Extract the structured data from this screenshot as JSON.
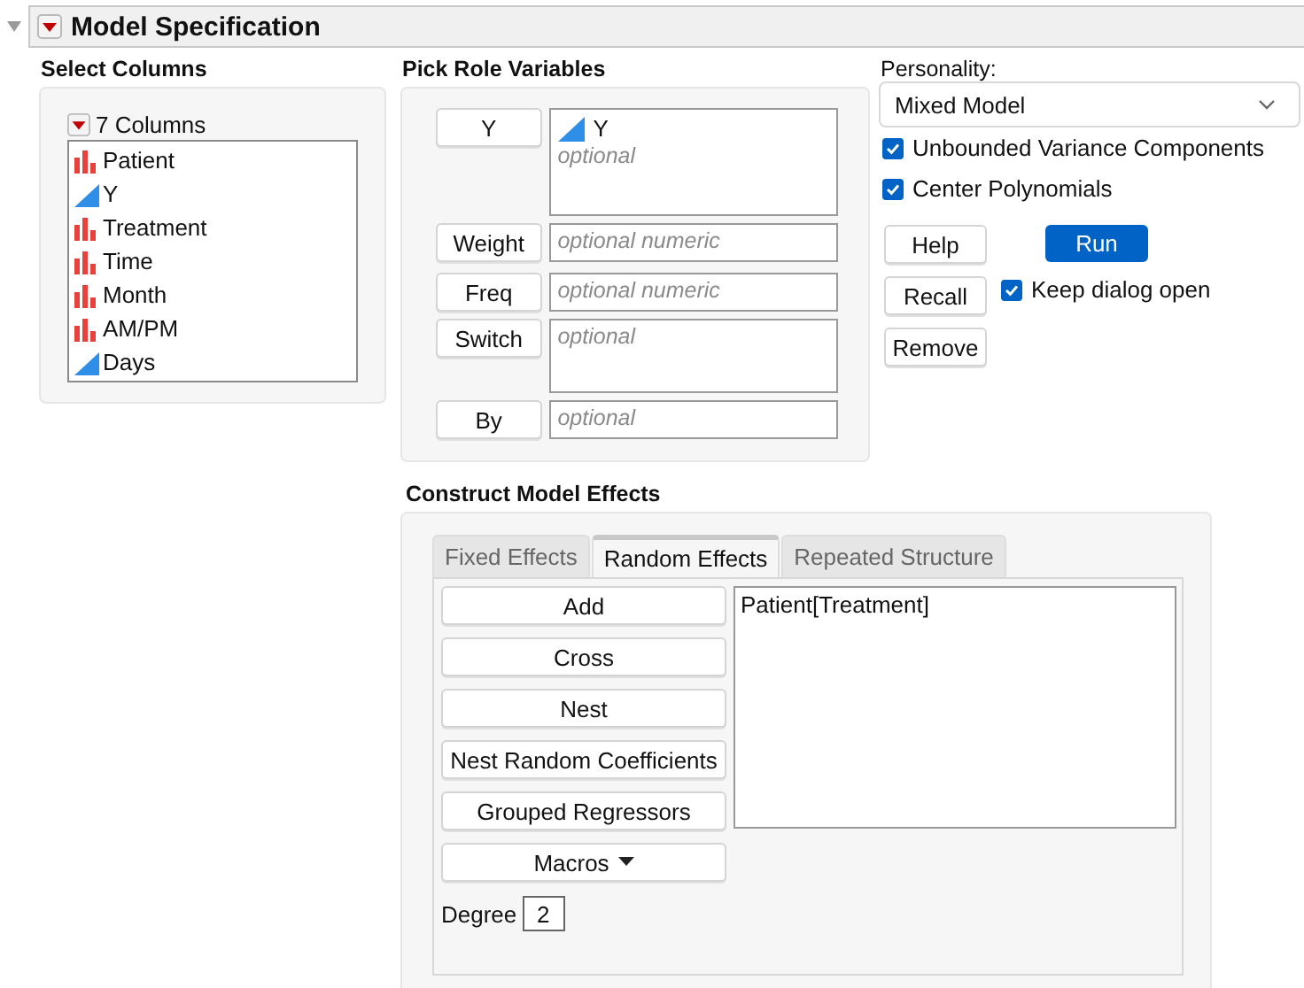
{
  "header": {
    "title": "Model Specification",
    "expanded": true
  },
  "select_columns": {
    "title": "Select Columns",
    "count_label": "7 Columns",
    "columns": [
      {
        "name": "Patient",
        "kind": "nominal"
      },
      {
        "name": "Y",
        "kind": "continuous"
      },
      {
        "name": "Treatment",
        "kind": "nominal"
      },
      {
        "name": "Time",
        "kind": "nominal"
      },
      {
        "name": "Month",
        "kind": "nominal"
      },
      {
        "name": "AM/PM",
        "kind": "nominal"
      },
      {
        "name": "Days",
        "kind": "continuous"
      }
    ]
  },
  "roles": {
    "title": "Pick Role Variables",
    "items": [
      {
        "button": "Y",
        "kind": "list",
        "values": [
          {
            "name": "Y",
            "kind": "continuous"
          }
        ],
        "placeholder": "optional"
      },
      {
        "button": "Weight",
        "kind": "line",
        "placeholder": "optional numeric"
      },
      {
        "button": "Freq",
        "kind": "line",
        "placeholder": "optional numeric"
      },
      {
        "button": "Switch",
        "kind": "list",
        "placeholder": "optional"
      },
      {
        "button": "By",
        "kind": "line",
        "placeholder": "optional"
      }
    ]
  },
  "personality": {
    "label": "Personality:",
    "value": "Mixed Model"
  },
  "options": [
    {
      "label": "Unbounded Variance Components",
      "checked": true
    },
    {
      "label": "Center Polynomials",
      "checked": true
    }
  ],
  "actions": {
    "help": "Help",
    "run": "Run",
    "recall": "Recall",
    "remove": "Remove",
    "keep_open": {
      "label": "Keep dialog open",
      "checked": true
    }
  },
  "construct": {
    "title": "Construct Model Effects",
    "tabs": [
      {
        "label": "Fixed Effects",
        "selected": false
      },
      {
        "label": "Random Effects",
        "selected": true
      },
      {
        "label": "Repeated Structure",
        "selected": false
      }
    ],
    "buttons": [
      {
        "label": "Add",
        "kind": "plain"
      },
      {
        "label": "Cross",
        "kind": "plain"
      },
      {
        "label": "Nest",
        "kind": "plain"
      },
      {
        "label": "Nest Random Coefficients",
        "kind": "plain"
      },
      {
        "label": "Grouped Regressors",
        "kind": "plain"
      },
      {
        "label": "Macros",
        "kind": "menu"
      }
    ],
    "degree_label": "Degree",
    "degree": "2",
    "effects": [
      "Patient[Treatment]"
    ]
  }
}
